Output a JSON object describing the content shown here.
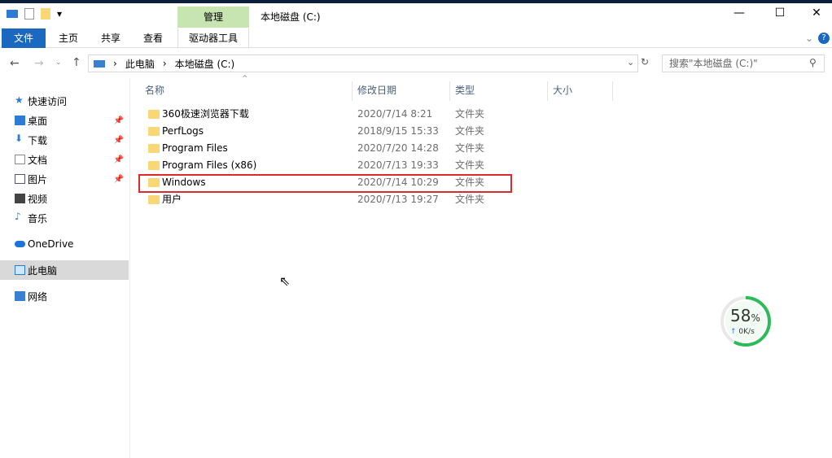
{
  "window": {
    "title": "本地磁盘 (C:)",
    "context_tab": "管理",
    "minimize": "—",
    "maximize": "☐",
    "close": "✕"
  },
  "ribbon": {
    "tabs": [
      "文件",
      "主页",
      "共享",
      "查看",
      "驱动器工具"
    ]
  },
  "address": {
    "crumbs": [
      "此电脑",
      "本地磁盘 (C:)"
    ],
    "search_placeholder": "搜索\"本地磁盘 (C:)\""
  },
  "nav": [
    {
      "label": "快速访问",
      "pinned": false
    },
    {
      "label": "桌面",
      "pinned": true
    },
    {
      "label": "下载",
      "pinned": true
    },
    {
      "label": "文档",
      "pinned": true
    },
    {
      "label": "图片",
      "pinned": true
    },
    {
      "label": "视频",
      "pinned": false
    },
    {
      "label": "音乐",
      "pinned": false
    },
    {
      "label": "OneDrive",
      "pinned": false
    },
    {
      "label": "此电脑",
      "pinned": false
    },
    {
      "label": "网络",
      "pinned": false
    }
  ],
  "columns": [
    "名称",
    "修改日期",
    "类型",
    "大小"
  ],
  "files": [
    {
      "name": "360极速浏览器下载",
      "date": "2020/7/14 8:21",
      "type": "文件夹"
    },
    {
      "name": "PerfLogs",
      "date": "2018/9/15 15:33",
      "type": "文件夹"
    },
    {
      "name": "Program Files",
      "date": "2020/7/20 14:28",
      "type": "文件夹"
    },
    {
      "name": "Program Files (x86)",
      "date": "2020/7/13 19:33",
      "type": "文件夹"
    },
    {
      "name": "Windows",
      "date": "2020/7/14 10:29",
      "type": "文件夹"
    },
    {
      "name": "用户",
      "date": "2020/7/13 19:27",
      "type": "文件夹"
    }
  ],
  "gauge": {
    "percent": "58",
    "unit": "%",
    "speed": "0K/s",
    "value": 0.58,
    "color": "#2dbb5a"
  }
}
